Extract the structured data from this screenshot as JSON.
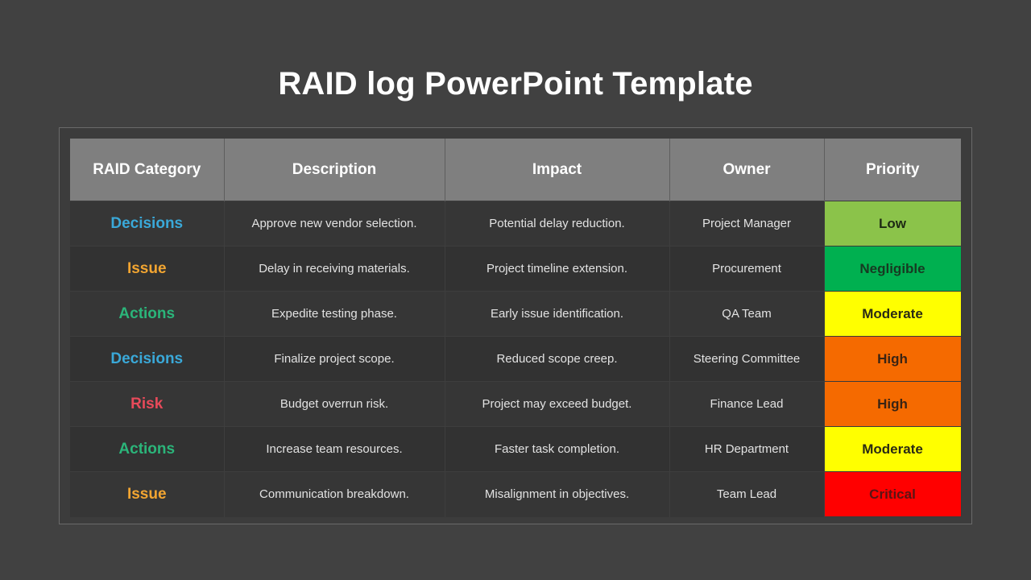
{
  "title": "RAID log PowerPoint Template",
  "table": {
    "headers": [
      "RAID Category",
      "Description",
      "Impact",
      "Owner",
      "Priority"
    ],
    "rows": [
      {
        "category": "Decisions",
        "category_color": "#3aa9d9",
        "description": "Approve new vendor selection.",
        "impact": "Potential delay reduction.",
        "owner": "Project Manager",
        "priority": "Low",
        "priority_bg": "#8bc34a",
        "priority_fg": "#1e2a14"
      },
      {
        "category": "Issue",
        "category_color": "#f2a531",
        "description": "Delay in receiving materials.",
        "impact": "Project timeline extension.",
        "owner": "Procurement",
        "priority": "Negligible",
        "priority_bg": "#00b050",
        "priority_fg": "#173a22"
      },
      {
        "category": "Actions",
        "category_color": "#2bb57a",
        "description": "Expedite testing phase.",
        "impact": "Early issue identification.",
        "owner": "QA Team",
        "priority": "Moderate",
        "priority_bg": "#ffff00",
        "priority_fg": "#2a2a14"
      },
      {
        "category": "Decisions",
        "category_color": "#3aa9d9",
        "description": "Finalize project scope.",
        "impact": "Reduced scope creep.",
        "owner": "Steering Committee",
        "priority": "High",
        "priority_bg": "#f56a00",
        "priority_fg": "#3a2414"
      },
      {
        "category": "Risk",
        "category_color": "#e84a5a",
        "description": "Budget overrun risk.",
        "impact": "Project may exceed budget.",
        "owner": "Finance Lead",
        "priority": "High",
        "priority_bg": "#f56a00",
        "priority_fg": "#3a2414"
      },
      {
        "category": "Actions",
        "category_color": "#2bb57a",
        "description": "Increase team resources.",
        "impact": "Faster task completion.",
        "owner": "HR Department",
        "priority": "Moderate",
        "priority_bg": "#ffff00",
        "priority_fg": "#2a2a14"
      },
      {
        "category": "Issue",
        "category_color": "#f2a531",
        "description": "Communication breakdown.",
        "impact": "Misalignment in objectives.",
        "owner": "Team Lead",
        "priority": "Critical",
        "priority_bg": "#ff0000",
        "priority_fg": "#5a1414"
      }
    ]
  }
}
